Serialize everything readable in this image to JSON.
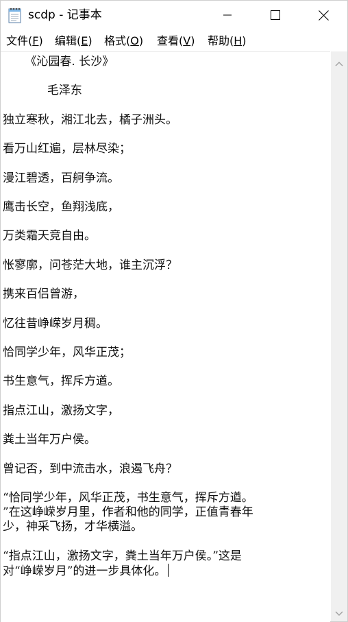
{
  "window": {
    "title": "scdp - 记事本"
  },
  "menu": {
    "items": [
      {
        "label": "文件(",
        "mnemonic": "F",
        "suffix": ")"
      },
      {
        "label": "编辑(",
        "mnemonic": "E",
        "suffix": ")"
      },
      {
        "label": "格式(",
        "mnemonic": "O",
        "suffix": ")"
      },
      {
        "label": "查看(",
        "mnemonic": "V",
        "suffix": ")"
      },
      {
        "label": "帮助(",
        "mnemonic": "H",
        "suffix": ")"
      }
    ]
  },
  "document": {
    "lines": [
      "      《沁园春. 长沙》",
      "",
      "            毛泽东",
      "",
      "独立寒秋，湘江北去，橘子洲头。",
      "",
      "看万山红遍，层林尽染；",
      "",
      "漫江碧透，百舸争流。",
      "",
      "鹰击长空，鱼翔浅底，",
      "",
      "万类霜天竞自由。",
      "",
      "怅寥廓，问苍茫大地，谁主沉浮？",
      "",
      "携来百侣曾游，",
      "",
      "忆往昔峥嵘岁月稠。",
      "",
      "恰同学少年，风华正茂；",
      "",
      "书生意气，挥斥方遒。",
      "",
      "指点江山，激扬文字，",
      "",
      "粪土当年万户侯。",
      "",
      "曾记否，到中流击水，浪遏飞舟？",
      "",
      "“恰同学少年，风华正茂，书生意气，挥斥方遒。",
      "”在这峥嵘岁月里，作者和他的同学，正值青春年",
      "少，神采飞扬，才华横溢。",
      "",
      "“指点江山，激扬文字，粪土当年万户侯。”这是",
      "对“峥嵘岁月”的进一步具体化。"
    ]
  }
}
